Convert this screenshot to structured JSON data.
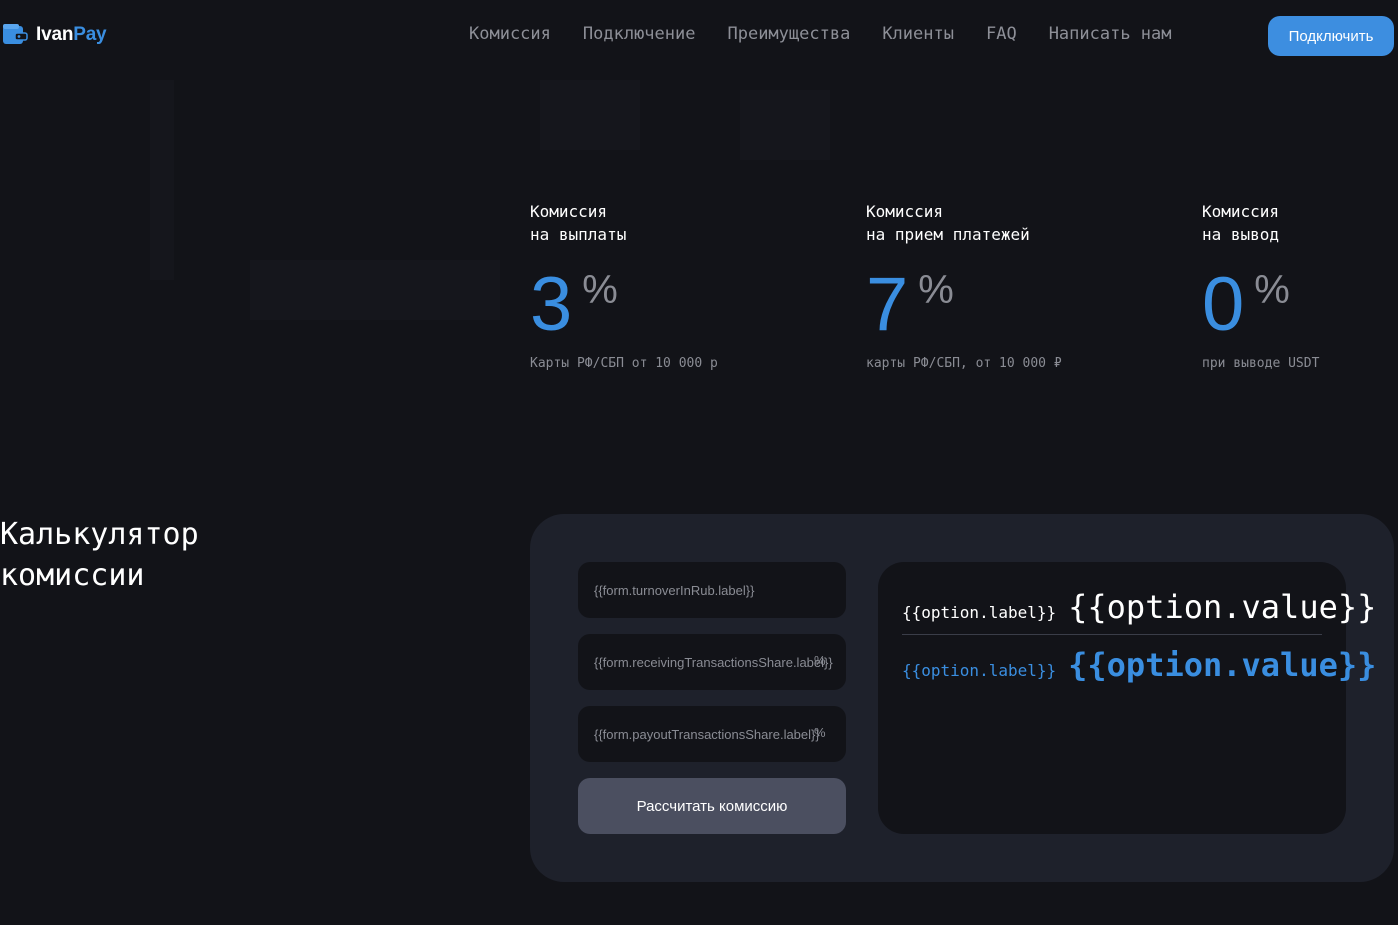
{
  "header": {
    "logo_part1": "Ivan",
    "logo_part2": "Pay",
    "nav": [
      "Комиссия",
      "Подключение",
      "Преимущества",
      "Клиенты",
      "FAQ",
      "Написать нам"
    ],
    "connect_label": "Подключить"
  },
  "commissions": [
    {
      "title": "Комиссия\nна выплаты",
      "value": "3",
      "unit": "%",
      "note": "Карты РФ/СБП от 10 000 р"
    },
    {
      "title": "Комиссия\nна прием платежей",
      "value": "7",
      "unit": "%",
      "note": "карты РФ/СБП, от 10 000 ₽"
    },
    {
      "title": "Комиссия\nна вывод",
      "value": "0",
      "unit": "%",
      "note": "при выводе USDT"
    }
  ],
  "calculator": {
    "title": "Калькулятор\nкомиссии",
    "fields": [
      {
        "placeholder": "{{form.turnoverInRub.label}}",
        "suffix": ""
      },
      {
        "placeholder": "{{form.receivingTransactionsShare.label}}",
        "suffix": "%"
      },
      {
        "placeholder": "{{form.payoutTransactionsShare.label}}",
        "suffix": "%"
      }
    ],
    "button_label": "Рассчитать комиссию",
    "results": [
      {
        "label": "{{option.label}}",
        "value": "{{option.value}}"
      },
      {
        "label": "{{option.label}}",
        "value": "{{option.value}}"
      }
    ]
  },
  "colors": {
    "accent": "#3a8ee0",
    "background": "#121318",
    "panel": "#1e212b"
  },
  "icons": {
    "logo": "wallet-icon"
  }
}
